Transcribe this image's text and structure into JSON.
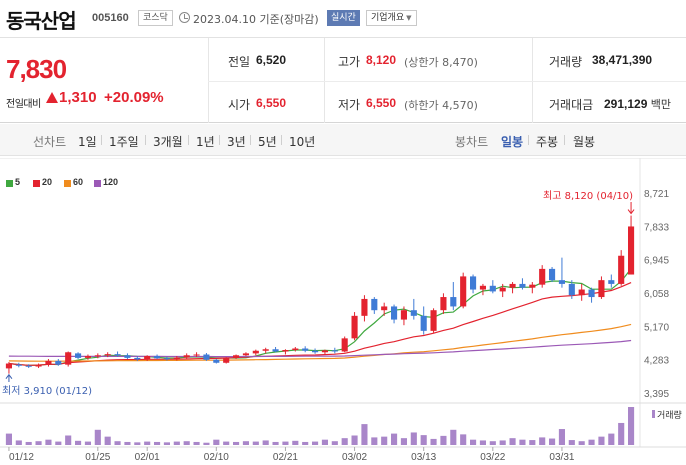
{
  "header": {
    "name": "동국산업",
    "code": "005160",
    "market": "코스닥",
    "date": "2023.04.10 기준(장마감)",
    "realtime": "실시간",
    "company_overview": "기업개요"
  },
  "price": {
    "current": "7,830",
    "change_label": "전일대비",
    "change_abs": "1,310",
    "change_pct": "+20.09%"
  },
  "summary": {
    "prev_label": "전일",
    "prev": "6,520",
    "open_label": "시가",
    "open": "6,550",
    "high_label": "고가",
    "high": "8,120",
    "high_sub": "(상한가 8,470)",
    "low_label": "저가",
    "low": "6,550",
    "low_sub": "(하한가 4,570)",
    "volume_label": "거래량",
    "volume": "38,471,390",
    "amount_label": "거래대금",
    "amount": "291,129",
    "amount_unit": "백만"
  },
  "toolbar": {
    "line_title": "선차트",
    "line_items": [
      "1일",
      "1주일",
      "3개월",
      "1년",
      "3년",
      "5년",
      "10년"
    ],
    "candle_title": "봉차트",
    "candle_items": [
      "일봉",
      "주봉",
      "월봉"
    ],
    "active_candle": "일봉"
  },
  "colors": {
    "up": "#e3232f",
    "down": "#3f7bd6",
    "ma5": "#3fa83f",
    "ma20": "#e3232f",
    "ma60": "#f08c1e",
    "ma120": "#9b59b6"
  },
  "chart_data": {
    "type": "candlestick",
    "legend": [
      {
        "label": "5",
        "color": "#3fa83f"
      },
      {
        "label": "20",
        "color": "#e3232f"
      },
      {
        "label": "60",
        "color": "#f08c1e"
      },
      {
        "label": "120",
        "color": "#9b59b6"
      }
    ],
    "y_ticks": [
      "8,721",
      "7,833",
      "6,945",
      "6,058",
      "5,170",
      "4,283",
      "3,395"
    ],
    "ylim": [
      3395,
      8721
    ],
    "x_ticks": [
      {
        "label": "01/12",
        "index": 0
      },
      {
        "label": "01/25",
        "index": 9
      },
      {
        "label": "02/01",
        "index": 14
      },
      {
        "label": "02/10",
        "index": 21
      },
      {
        "label": "02/21",
        "index": 28
      },
      {
        "label": "03/02",
        "index": 35
      },
      {
        "label": "03/13",
        "index": 42
      },
      {
        "label": "03/22",
        "index": 49
      },
      {
        "label": "03/31",
        "index": 56
      }
    ],
    "high_note": "최고 8,120 (04/10)",
    "low_note": "최저 3,910 (01/12)",
    "volume_label": "거래량",
    "candles": [
      [
        4050,
        4220,
        3910,
        4180
      ],
      [
        4150,
        4200,
        4080,
        4120
      ],
      [
        4120,
        4160,
        4060,
        4100
      ],
      [
        4100,
        4180,
        4060,
        4150
      ],
      [
        4150,
        4300,
        4100,
        4250
      ],
      [
        4250,
        4300,
        4120,
        4150
      ],
      [
        4150,
        4500,
        4100,
        4480
      ],
      [
        4450,
        4480,
        4300,
        4330
      ],
      [
        4330,
        4420,
        4280,
        4380
      ],
      [
        4380,
        4450,
        4320,
        4400
      ],
      [
        4400,
        4480,
        4350,
        4430
      ],
      [
        4430,
        4500,
        4360,
        4400
      ],
      [
        4400,
        4450,
        4300,
        4330
      ],
      [
        4330,
        4380,
        4250,
        4290
      ],
      [
        4290,
        4400,
        4250,
        4380
      ],
      [
        4380,
        4420,
        4300,
        4320
      ],
      [
        4320,
        4360,
        4260,
        4300
      ],
      [
        4300,
        4380,
        4260,
        4340
      ],
      [
        4340,
        4450,
        4300,
        4400
      ],
      [
        4400,
        4480,
        4350,
        4420
      ],
      [
        4420,
        4460,
        4250,
        4280
      ],
      [
        4280,
        4300,
        4180,
        4200
      ],
      [
        4200,
        4350,
        4180,
        4330
      ],
      [
        4330,
        4420,
        4300,
        4400
      ],
      [
        4400,
        4480,
        4380,
        4450
      ],
      [
        4450,
        4550,
        4400,
        4520
      ],
      [
        4520,
        4600,
        4450,
        4560
      ],
      [
        4560,
        4620,
        4480,
        4500
      ],
      [
        4500,
        4560,
        4420,
        4540
      ],
      [
        4540,
        4620,
        4500,
        4580
      ],
      [
        4580,
        4640,
        4480,
        4520
      ],
      [
        4520,
        4580,
        4440,
        4480
      ],
      [
        4480,
        4550,
        4430,
        4530
      ],
      [
        4530,
        4600,
        4450,
        4500
      ],
      [
        4500,
        4900,
        4480,
        4850
      ],
      [
        4850,
        5550,
        4800,
        5450
      ],
      [
        5450,
        6000,
        5300,
        5900
      ],
      [
        5900,
        5950,
        5500,
        5600
      ],
      [
        5600,
        5800,
        5450,
        5700
      ],
      [
        5700,
        5750,
        5250,
        5350
      ],
      [
        5350,
        5700,
        5200,
        5600
      ],
      [
        5600,
        5900,
        5350,
        5450
      ],
      [
        5450,
        5700,
        4950,
        5050
      ],
      [
        5050,
        5650,
        5000,
        5600
      ],
      [
        5600,
        6050,
        5500,
        5950
      ],
      [
        5950,
        6350,
        5600,
        5700
      ],
      [
        5700,
        6600,
        5650,
        6500
      ],
      [
        6500,
        6550,
        6050,
        6150
      ],
      [
        6150,
        6300,
        6000,
        6250
      ],
      [
        6250,
        6400,
        6050,
        6100
      ],
      [
        6100,
        6300,
        5950,
        6200
      ],
      [
        6200,
        6350,
        6050,
        6300
      ],
      [
        6300,
        6450,
        6150,
        6200
      ],
      [
        6200,
        6350,
        6050,
        6280
      ],
      [
        6280,
        6800,
        6200,
        6700
      ],
      [
        6700,
        6750,
        6350,
        6400
      ],
      [
        6400,
        7000,
        6200,
        6300
      ],
      [
        6300,
        6400,
        5900,
        6000
      ],
      [
        6000,
        6300,
        5850,
        6150
      ],
      [
        6150,
        6200,
        5800,
        5950
      ],
      [
        5950,
        6500,
        5900,
        6400
      ],
      [
        6400,
        6550,
        6200,
        6300
      ],
      [
        6300,
        7200,
        6250,
        7050
      ],
      [
        6550,
        8120,
        6550,
        7830
      ]
    ],
    "volumes": [
      30,
      12,
      8,
      10,
      14,
      9,
      25,
      11,
      9,
      40,
      22,
      10,
      8,
      7,
      9,
      8,
      7,
      9,
      10,
      8,
      6,
      14,
      9,
      8,
      10,
      9,
      12,
      8,
      9,
      11,
      8,
      9,
      14,
      10,
      18,
      25,
      55,
      20,
      22,
      30,
      18,
      33,
      26,
      16,
      24,
      40,
      28,
      14,
      12,
      10,
      12,
      18,
      14,
      13,
      20,
      17,
      42,
      13,
      10,
      14,
      22,
      30,
      58,
      100
    ]
  }
}
